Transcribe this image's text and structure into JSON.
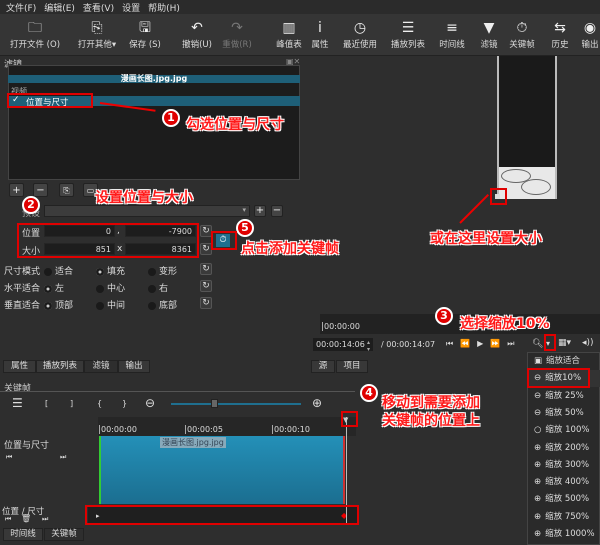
{
  "menu": [
    "文件(F)",
    "编辑(E)",
    "查看(V)",
    "设置",
    "帮助(H)"
  ],
  "toolbar": [
    {
      "label": "打开文件 (O)",
      "icon": "folder-icon",
      "glyph": "🗀"
    },
    {
      "label": "打开其他▾",
      "icon": "open-other-icon",
      "glyph": "⎘"
    },
    {
      "label": "保存 (S)",
      "icon": "save-icon",
      "glyph": "🖫"
    },
    {
      "label": "撤销(U)",
      "icon": "undo-icon",
      "glyph": "↶"
    },
    {
      "label": "重做(R)",
      "icon": "redo-icon",
      "glyph": "↷"
    },
    {
      "label": "峰值表",
      "icon": "peak-meter-icon",
      "glyph": "▥"
    },
    {
      "label": "属性",
      "icon": "info-icon",
      "glyph": "i"
    },
    {
      "label": "最近使用",
      "icon": "clock-icon",
      "glyph": "◷"
    },
    {
      "label": "播放列表",
      "icon": "list-icon",
      "glyph": "☰"
    },
    {
      "label": "时间线",
      "icon": "timeline-icon",
      "glyph": "≡"
    },
    {
      "label": "滤镜",
      "icon": "filter-icon",
      "glyph": "▼"
    },
    {
      "label": "关键帧",
      "icon": "stopwatch-icon",
      "glyph": "⏱"
    },
    {
      "label": "历史",
      "icon": "history-icon",
      "glyph": "⇆"
    },
    {
      "label": "输出",
      "icon": "export-icon",
      "glyph": "◉"
    }
  ],
  "filters": {
    "title": "滤镜",
    "clip_name": "漫画长图.jpg.jpg",
    "group": "视频",
    "items": [
      {
        "label": "位置与尺寸",
        "checked": true
      }
    ],
    "preset_label": "预设",
    "position_label": "位置",
    "position_x": "0",
    "position_sep": ",",
    "position_y": "-7900",
    "size_label": "大小",
    "size_w": "851",
    "size_sep": "x",
    "size_h": "8361",
    "size_mode": {
      "label": "尺寸模式",
      "options": [
        "适合",
        "填充",
        "变形"
      ],
      "selected": "填充"
    },
    "h_fit": {
      "label": "水平适合",
      "options": [
        "左",
        "中心",
        "右"
      ],
      "selected": "左"
    },
    "v_fit": {
      "label": "垂直适合",
      "options": [
        "顶部",
        "中间",
        "底部"
      ],
      "selected": "顶部"
    }
  },
  "player": {
    "ruler_start": "00:00:00",
    "current": "00:00:14:06",
    "duration": "/ 00:00:14:07"
  },
  "zoom_menu": {
    "items": [
      "缩放适合",
      "缩放10%",
      "缩放 25%",
      "缩放 50%",
      "缩放 100%",
      "缩放 200%",
      "缩放 300%",
      "缩放 400%",
      "缩放 500%",
      "缩放 750%",
      "缩放 1000%"
    ],
    "selected": "缩放10%"
  },
  "tabs_left": [
    "属性",
    "播放列表",
    "滤镜",
    "输出"
  ],
  "tabs_right": [
    "源",
    "项目"
  ],
  "keyframes": {
    "title": "关键帧",
    "toolbar": [
      "[",
      "]",
      "{",
      "}"
    ],
    "ruler": [
      "00:00:00",
      "00:00:05",
      "00:00:10"
    ],
    "track_name": "位置与尺寸",
    "clip_name": "漫画长图.jpg.jpg",
    "param_name": "位置 / 尺寸"
  },
  "bottom_tabs": [
    "时间线",
    "关键帧"
  ],
  "annotations": {
    "n1": "1",
    "t1": "勾选位置与尺寸",
    "n2": "2",
    "t2": "设置位置与大小",
    "n3": "3",
    "t3": "选择缩放10%",
    "n4": "4",
    "t4a": "移动到需要添加",
    "t4b": "关键帧的位置上",
    "n5": "5",
    "t5": "点击添加关键帧",
    "t6": "或在这里设置大小"
  },
  "colors": {
    "accent": "#1f6f8f",
    "annotation": "#e00000"
  }
}
